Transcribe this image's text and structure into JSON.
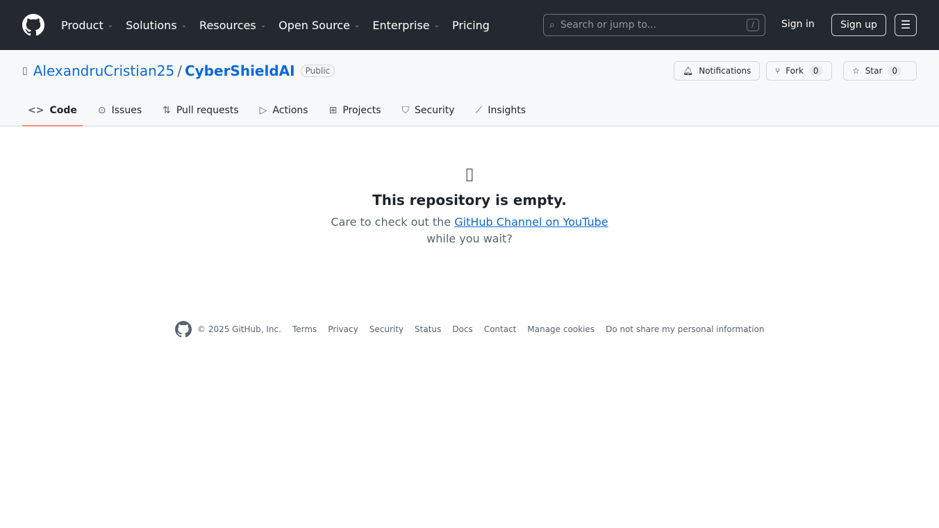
{
  "header": {
    "nav": [
      "Product",
      "Solutions",
      "Resources",
      "Open Source",
      "Enterprise",
      "Pricing"
    ],
    "search_placeholder": "Search or jump to...",
    "search_key": "/",
    "sign_in": "Sign in",
    "sign_up": "Sign up"
  },
  "repo": {
    "owner": "AlexandruCristian25",
    "sep": "/",
    "name": "CyberShieldAI",
    "visibility": "Public",
    "notifications": "Notifications",
    "fork": "Fork",
    "fork_count": "0",
    "star": "Star",
    "star_count": "0"
  },
  "tabs": [
    {
      "label": "Code",
      "icon": "<>"
    },
    {
      "label": "Issues",
      "icon": "⊙"
    },
    {
      "label": "Pull requests",
      "icon": "⇅"
    },
    {
      "label": "Actions",
      "icon": "▷"
    },
    {
      "label": "Projects",
      "icon": "⊞"
    },
    {
      "label": "Security",
      "icon": "⛉"
    },
    {
      "label": "Insights",
      "icon": "⟋"
    }
  ],
  "empty": {
    "title": "This repository is empty.",
    "text": "Care to check out the",
    "link": "GitHub Channel on YouTube",
    "text2": "while you wait?"
  },
  "footer": {
    "copyright": "© 2025 GitHub, Inc.",
    "links": [
      "Terms",
      "Privacy",
      "Security",
      "Status",
      "Docs",
      "Contact",
      "Manage cookies",
      "Do not share my personal information"
    ]
  }
}
